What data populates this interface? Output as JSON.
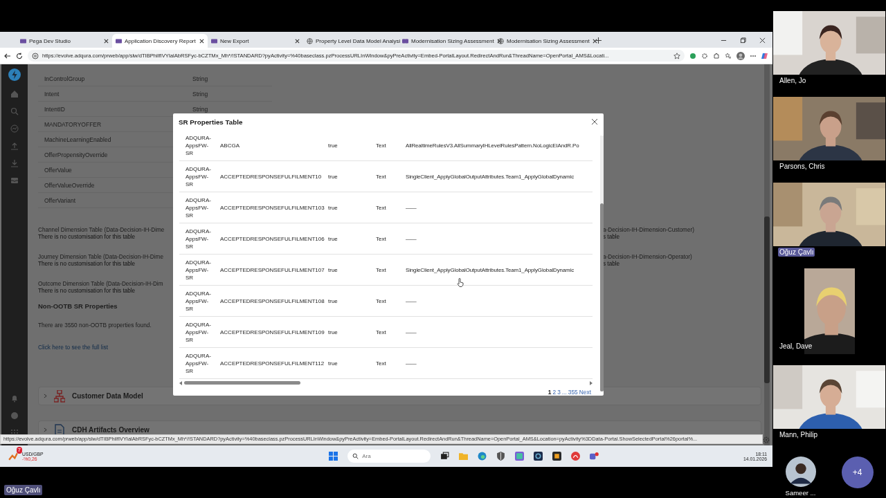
{
  "browser": {
    "tabs": [
      {
        "label": "Pega Dev Studio",
        "kind": "logo",
        "selected": false
      },
      {
        "label": "Application Discovery Report",
        "kind": "logo",
        "selected": true
      },
      {
        "label": "New Export",
        "kind": "logo",
        "selected": false
      },
      {
        "label": "Property Level Data Model Analysi",
        "kind": "globe",
        "selected": false
      },
      {
        "label": "Modernisation Sizing Assessment",
        "kind": "logo",
        "selected": false
      },
      {
        "label": "Modernisation Sizing Assessment",
        "kind": "globe",
        "selected": false
      }
    ],
    "url": "https://evolve.adqura.com/prweb/app/slw/dTIBPhilfIVYIalAbRSFyc-bCZTMx_Mh*/!STANDARD?pyActivity=%40baseclass.pzProcessURLInWindow&pyPreActivity=Embed-PortalLayout.RedirectAndRun&ThreadName=OpenPortal_AMS&Locati...",
    "page": {
      "properties": [
        {
          "name": "InControlGroup",
          "type": "String"
        },
        {
          "name": "Intent",
          "type": "String"
        },
        {
          "name": "IntentID",
          "type": "String"
        },
        {
          "name": "MANDATORYOFFER"
        },
        {
          "name": "MachineLearningEnabled"
        },
        {
          "name": "OfferPropensityOverride"
        },
        {
          "name": "OfferValue"
        },
        {
          "name": "OfferValueOverride"
        },
        {
          "name": "OfferVariant"
        }
      ],
      "dimension_tables": [
        {
          "title": "Channel Dimension Table (Data-Decision-IH-Dime",
          "note": "There is no customisation for this table",
          "title_right": "a-Decision-IH-Dimension-Customer)",
          "note_right": "s table"
        },
        {
          "title": "Journey Dimension Table (Data-Decision-IH-Dime",
          "note": "There is no customisation for this table",
          "title_right": "a-Decision-IH-Dimension-Operator)",
          "note_right": "s table"
        },
        {
          "title": "Outcome Dimension Table (Data-Decision-IH-Dim",
          "note": "There is no customisation for this table"
        }
      ],
      "non_ootb": {
        "heading": "Non-OOTB SR Properties",
        "summary": "There are 3550 non-OOTB properties found.",
        "link": "Click here to see the full list"
      },
      "sections": [
        {
          "title": "Customer Data Model",
          "kind": "hierarchy",
          "expanded": false
        },
        {
          "title": "CDH Artifacts Overview",
          "kind": "document",
          "expanded": false
        }
      ],
      "modal": {
        "title": "SR Properties Table",
        "rows": [
          {
            "column_1": "ADQURA-AppsFW-SR",
            "column_2": "ABCGA",
            "column_3": "true",
            "column_4": "Text",
            "column_5": "AllRealtimeRulesV3.AllSummaryIHLevelRulesPattern.NoLogicEIAndR.Po"
          },
          {
            "column_1": "ADQURA-AppsFW-SR",
            "column_2": "ACCEPTEDRESPONSEFULFILMENT10",
            "column_3": "true",
            "column_4": "Text",
            "column_5": "SingleClient_ApplyGlobalOutputAttributes.Team1_ApplyGlobalDynamic"
          },
          {
            "column_1": "ADQURA-AppsFW-SR",
            "column_2": "ACCEPTEDRESPONSEFULFILMENT103",
            "column_3": "true",
            "column_4": "Text",
            "column_5": "——"
          },
          {
            "column_1": "ADQURA-AppsFW-SR",
            "column_2": "ACCEPTEDRESPONSEFULFILMENT106",
            "column_3": "true",
            "column_4": "Text",
            "column_5": "——"
          },
          {
            "column_1": "ADQURA-AppsFW-SR",
            "column_2": "ACCEPTEDRESPONSEFULFILMENT107",
            "column_3": "true",
            "column_4": "Text",
            "column_5": "SingleClient_ApplyGlobalOutputAttributes.Team1_ApplyGlobalDynamic"
          },
          {
            "column_1": "ADQURA-AppsFW-SR",
            "column_2": "ACCEPTEDRESPONSEFULFILMENT108",
            "column_3": "true",
            "column_4": "Text",
            "column_5": "——"
          },
          {
            "column_1": "ADQURA-AppsFW-SR",
            "column_2": "ACCEPTEDRESPONSEFULFILMENT109",
            "column_3": "true",
            "column_4": "Text",
            "column_5": "——"
          },
          {
            "column_1": "ADQURA-AppsFW-SR",
            "column_2": "ACCEPTEDRESPONSEFULFILMENT112",
            "column_3": "true",
            "column_4": "Text",
            "column_5": "——"
          }
        ],
        "pagination": {
          "pages": [
            {
              "label": "1",
              "selected": true
            },
            {
              "label": "2",
              "selected": false
            },
            {
              "label": "3",
              "selected": false
            }
          ],
          "ellipsis": "...",
          "last": "355",
          "next": "Next"
        }
      }
    },
    "status_url": "https://evolve.adqura.com/prweb/app/slw/dTIBPhilfIVYIalAbRSFyc-bCZTMx_Mh*/!STANDARD?pyActivity=%40baseclass.pzProcessURLInWindow&pyPreActivity=Embed-PortalLayout.RedirectAndRun&ThreadName=OpenPortal_AMS&Location=pyActivity%3DData-Portal.ShowSelectedPortal%26portal%..."
  },
  "taskbar": {
    "widget": {
      "badge": "7",
      "title": "USD/GBP",
      "change": "-%0,26"
    },
    "search": {
      "placeholder": "Ara"
    },
    "time": "18:11",
    "date": "14.01.2026"
  },
  "participants": [
    {
      "name": "Allen, Jo",
      "kind": "wide",
      "highlighted": false
    },
    {
      "name": "Parsons, Chris",
      "kind": "wide",
      "highlighted": false
    },
    {
      "name": "Oğuz Çavlı",
      "kind": "wide",
      "highlighted": true
    },
    {
      "name": "Jeal, Dave",
      "kind": "portrait",
      "highlighted": false
    },
    {
      "name": "Mann, Philip",
      "kind": "wide",
      "highlighted": false
    }
  ],
  "more_participants": {
    "name": "Sameer ...",
    "count": "+4"
  },
  "presenter": "Oğuz Çavlı"
}
